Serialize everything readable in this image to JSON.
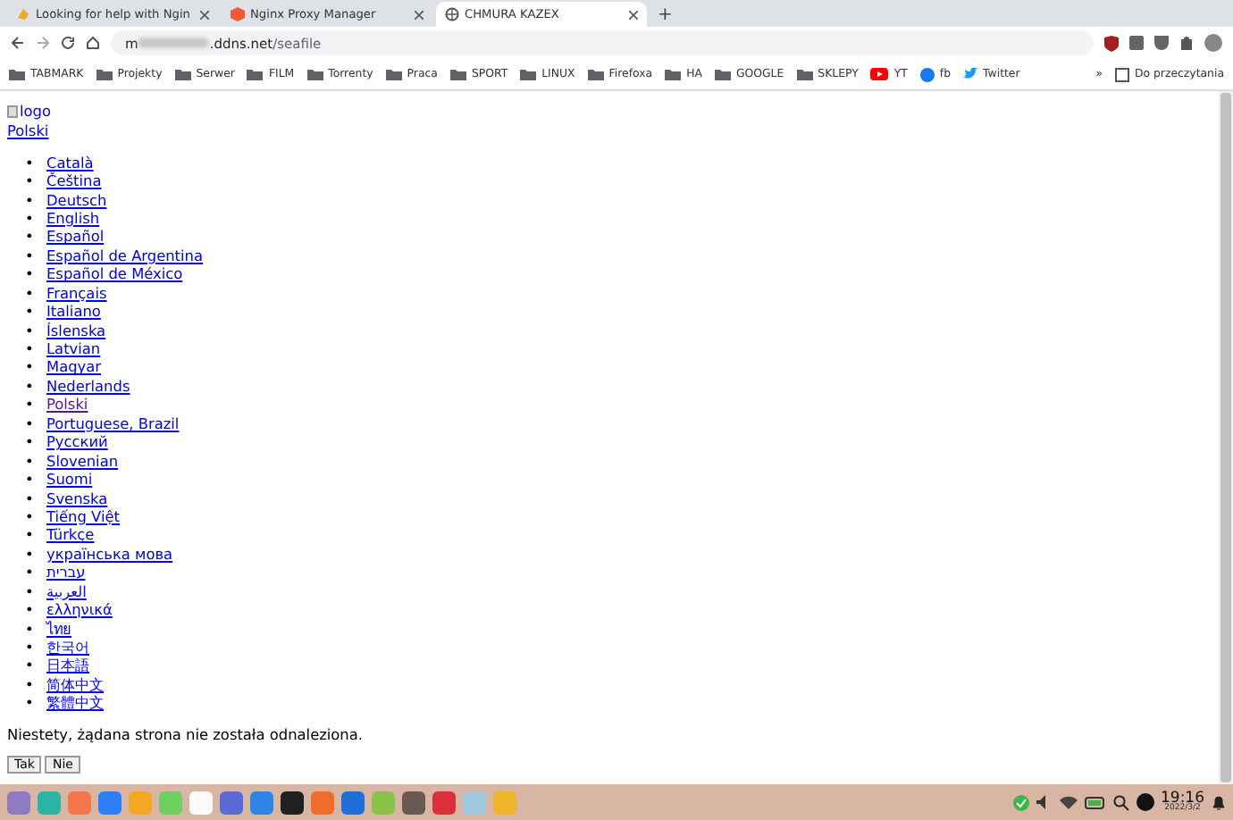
{
  "tabs": [
    {
      "title": "Looking for help with Ngin",
      "selected": false
    },
    {
      "title": "Nginx Proxy Manager",
      "selected": false
    },
    {
      "title": "CHMURA KAZEX",
      "selected": true
    }
  ],
  "bullet": "•",
  "new_tab": "+",
  "address": {
    "start": "m",
    "rest": ".ddns.net/seafile"
  },
  "bookmarks": [
    {
      "kind": "folder",
      "label": "TABMARK"
    },
    {
      "kind": "folder",
      "label": "Projekty"
    },
    {
      "kind": "folder",
      "label": "Serwer"
    },
    {
      "kind": "folder",
      "label": "FILM"
    },
    {
      "kind": "folder",
      "label": "Torrenty"
    },
    {
      "kind": "folder",
      "label": "Praca"
    },
    {
      "kind": "folder",
      "label": "SPORT"
    },
    {
      "kind": "folder",
      "label": "LINUX"
    },
    {
      "kind": "folder",
      "label": "Firefoxa"
    },
    {
      "kind": "folder",
      "label": "HA"
    },
    {
      "kind": "folder",
      "label": "GOOGLE"
    },
    {
      "kind": "folder",
      "label": "SKLEPY"
    },
    {
      "kind": "youtube",
      "label": "YT"
    },
    {
      "kind": "facebook",
      "label": "fb"
    },
    {
      "kind": "twitter",
      "label": "Twitter"
    }
  ],
  "overflow": "»",
  "reading_list": "Do przeczytania",
  "logo_alt": "logo",
  "current_language": "Polski",
  "languages": [
    {
      "label": "Català",
      "visited": false
    },
    {
      "label": "Čeština",
      "visited": false
    },
    {
      "label": "Deutsch",
      "visited": false
    },
    {
      "label": "English",
      "visited": false
    },
    {
      "label": "Español",
      "visited": false
    },
    {
      "label": "Español de Argentina",
      "visited": false
    },
    {
      "label": "Español de México",
      "visited": false
    },
    {
      "label": "Français",
      "visited": false
    },
    {
      "label": "Italiano",
      "visited": false
    },
    {
      "label": "Íslenska",
      "visited": false
    },
    {
      "label": "Latvian",
      "visited": false
    },
    {
      "label": "Magyar",
      "visited": false
    },
    {
      "label": "Nederlands",
      "visited": false
    },
    {
      "label": "Polski",
      "visited": true
    },
    {
      "label": "Portuguese, Brazil",
      "visited": false
    },
    {
      "label": "Русский",
      "visited": false
    },
    {
      "label": "Slovenian",
      "visited": false
    },
    {
      "label": "Suomi",
      "visited": false
    },
    {
      "label": "Svenska",
      "visited": false
    },
    {
      "label": "Tiếng Việt",
      "visited": false
    },
    {
      "label": "Türkçe",
      "visited": false
    },
    {
      "label": "українська мова",
      "visited": false
    },
    {
      "label": "עברית",
      "visited": false
    },
    {
      "label": "العربية",
      "visited": false
    },
    {
      "label": "ελληνικά",
      "visited": false
    },
    {
      "label": "ไทย",
      "visited": false
    },
    {
      "label": "한국어",
      "visited": false
    },
    {
      "label": "日本語",
      "visited": false
    },
    {
      "label": "简体中文",
      "visited": false
    },
    {
      "label": "繁體中文",
      "visited": false
    }
  ],
  "message": "Niestety, żądana strona nie została odnaleziona.",
  "buttons": [
    "Tak",
    "Nie"
  ],
  "clock": {
    "time": "19:16",
    "date": "2022/3/2"
  }
}
